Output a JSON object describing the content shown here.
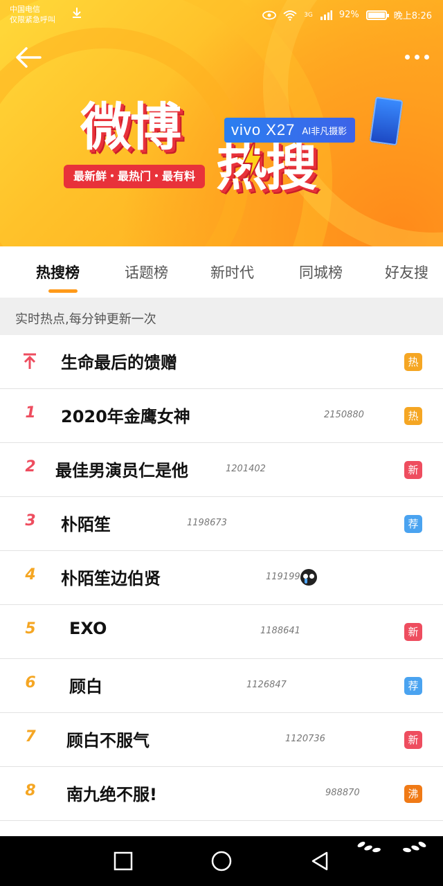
{
  "status_bar": {
    "carrier_line1": "中国电信",
    "carrier_line2": "仅限紧急呼叫",
    "signal": "3G",
    "battery": "92%",
    "battery_level": 0.92,
    "time": "晚上8:26"
  },
  "header": {
    "logo_part1": "微博",
    "logo_part2": "热搜",
    "slogan": "最新鲜・最热门・最有料",
    "sponsor_brand": "vivo X27",
    "sponsor_tagline": "AI非凡摄影"
  },
  "tabs": [
    "热搜榜",
    "话题榜",
    "新时代",
    "同城榜",
    "好友搜"
  ],
  "active_tab": 0,
  "hint": "实时热点,每分钟更新一次",
  "items": [
    {
      "rank": "",
      "pinned": true,
      "title": "生命最后的馈赠",
      "count": "",
      "badge": "热",
      "badge_color": "#f5a623"
    },
    {
      "rank": "1",
      "title": "2020年金鹰女神",
      "count": "2150880",
      "badge": "热",
      "badge_color": "#f5a623"
    },
    {
      "rank": "2",
      "title": "最佳男演员仁是他",
      "count": "1201402",
      "badge": "新",
      "badge_color": "#ee4d5f"
    },
    {
      "rank": "3",
      "title": "朴陌笙",
      "count": "1198673",
      "badge": "荐",
      "badge_color": "#4aa3f0"
    },
    {
      "rank": "4",
      "title": "朴陌笙边伯贤",
      "count": "1191995",
      "badge": "",
      "badge_color": "",
      "emoji": "crying-face"
    },
    {
      "rank": "5",
      "title": "EXO",
      "count": "1188641",
      "badge": "新",
      "badge_color": "#ee4d5f"
    },
    {
      "rank": "6",
      "title": "顾白",
      "count": "1126847",
      "badge": "荐",
      "badge_color": "#4aa3f0"
    },
    {
      "rank": "7",
      "title": "顾白不服气",
      "count": "1120736",
      "badge": "新",
      "badge_color": "#ee4d5f"
    },
    {
      "rank": "8",
      "title": "南九绝不服!",
      "count": "988870",
      "badge": "沸",
      "badge_color": "#f07a16"
    }
  ],
  "icons": {
    "back": "back-arrow-icon",
    "more": "more-dots-icon",
    "nav": [
      "square-recent-icon",
      "circle-home-icon",
      "triangle-back-icon"
    ]
  },
  "colors": {
    "accent": "#ff9a1a",
    "rank_top": "#ee4d5f",
    "rank_other": "#f5a623",
    "brand_red": "#e8323a",
    "sponsor_blue": "#2b7ff0"
  }
}
